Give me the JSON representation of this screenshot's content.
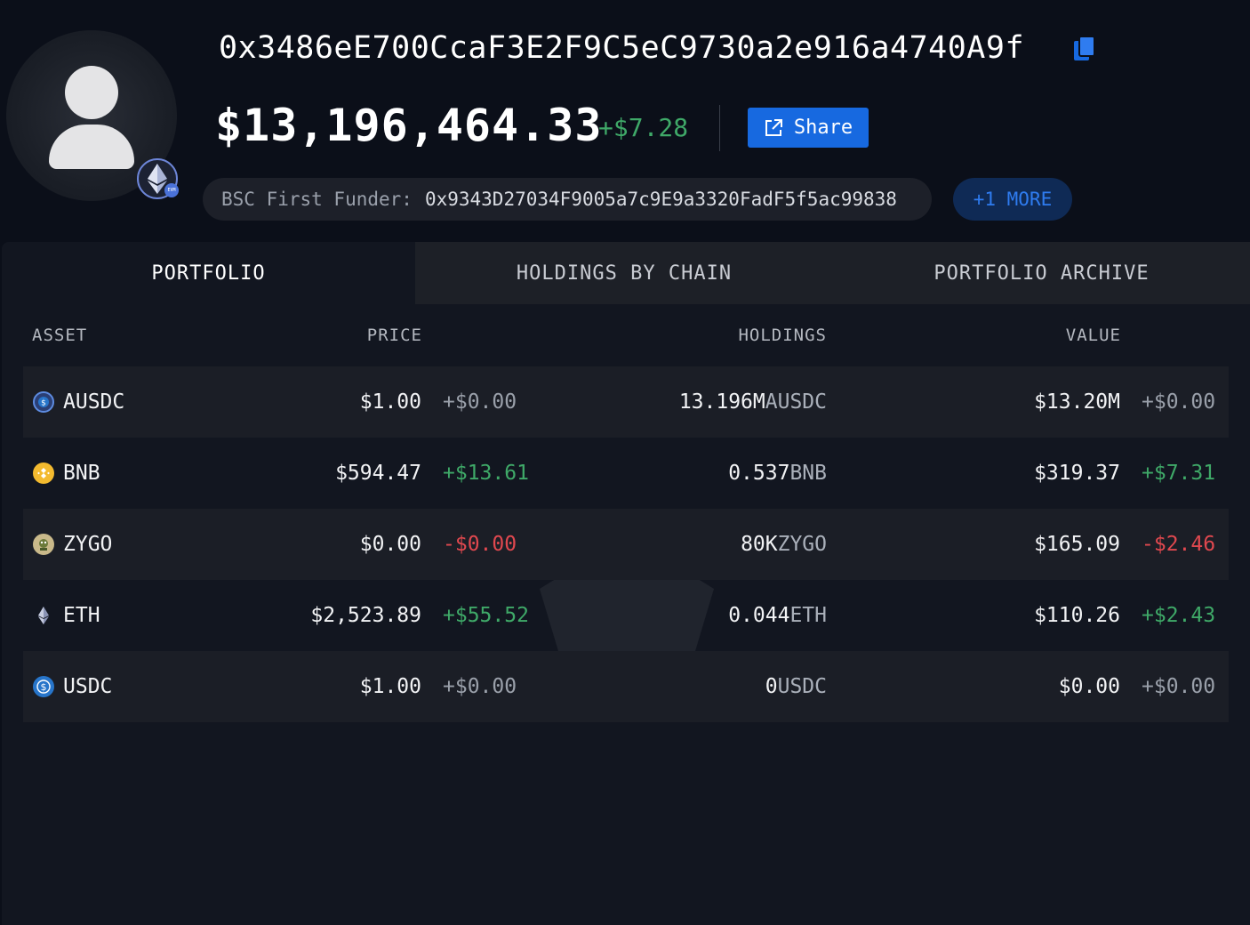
{
  "profile": {
    "address": "0x3486eE700CcaF3E2F9C5eC9730a2e916a4740A9f",
    "balance": "$13,196,464.33",
    "balance_change": "+$7.28",
    "share_label": "Share",
    "chain_badge": "EVM",
    "funder_label": "BSC First Funder:",
    "funder_address": "0x9343D27034F9005a7c9E9a3320FadF5f5ac99838",
    "more_label": "+1 MORE"
  },
  "tabs": [
    {
      "label": "PORTFOLIO",
      "active": true
    },
    {
      "label": "HOLDINGS BY CHAIN",
      "active": false
    },
    {
      "label": "PORTFOLIO ARCHIVE",
      "active": false
    }
  ],
  "columns": {
    "asset": "ASSET",
    "price": "PRICE",
    "holdings": "HOLDINGS",
    "value": "VALUE"
  },
  "assets": [
    {
      "symbol": "AUSDC",
      "icon": "ausdc-icon",
      "price": "$1.00",
      "price_change": "+$0.00",
      "price_trend": "neutral",
      "amount": "13.196M",
      "unit": "AUSDC",
      "value": "$13.20M",
      "value_change": "+$0.00",
      "value_trend": "neutral"
    },
    {
      "symbol": "BNB",
      "icon": "bnb-icon",
      "price": "$594.47",
      "price_change": "+$13.61",
      "price_trend": "positive",
      "amount": "0.537",
      "unit": "BNB",
      "value": "$319.37",
      "value_change": "+$7.31",
      "value_trend": "positive"
    },
    {
      "symbol": "ZYGO",
      "icon": "zygo-icon",
      "price": "$0.00",
      "price_change": "-$0.00",
      "price_trend": "negative",
      "amount": "80K",
      "unit": "ZYGO",
      "value": "$165.09",
      "value_change": "-$2.46",
      "value_trend": "negative"
    },
    {
      "symbol": "ETH",
      "icon": "eth-icon",
      "price": "$2,523.89",
      "price_change": "+$55.52",
      "price_trend": "positive",
      "amount": "0.044",
      "unit": "ETH",
      "value": "$110.26",
      "value_change": "+$2.43",
      "value_trend": "positive"
    },
    {
      "symbol": "USDC",
      "icon": "usdc-icon",
      "price": "$1.00",
      "price_change": "+$0.00",
      "price_trend": "neutral",
      "amount": "0",
      "unit": "USDC",
      "value": "$0.00",
      "value_change": "+$0.00",
      "value_trend": "neutral"
    }
  ],
  "colors": {
    "background": "#0b0f19",
    "panel": "#121620",
    "accent": "#1769e0",
    "positive": "#3fa968",
    "negative": "#e0484f",
    "neutral": "#9aa0aa"
  }
}
